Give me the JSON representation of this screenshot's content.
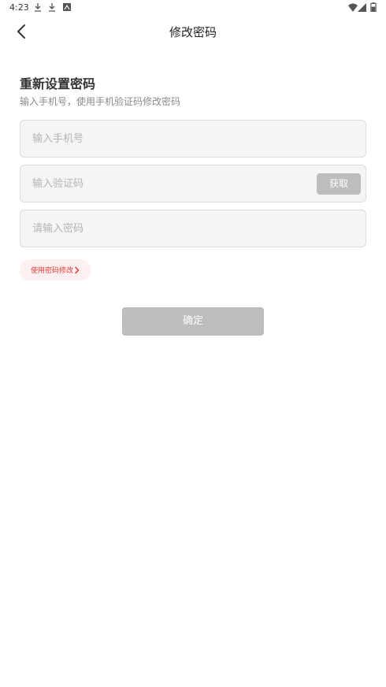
{
  "status_bar": {
    "time": "4:23",
    "icons": [
      "download-icon",
      "download-icon",
      "photo-icon",
      "wifi-icon",
      "signal-icon",
      "battery-icon"
    ]
  },
  "header": {
    "title": "修改密码",
    "back_icon": "chevron-left-icon"
  },
  "form": {
    "title": "重新设置密码",
    "subtitle": "输入手机号，使用手机验证码修改密码",
    "phone_placeholder": "输入手机号",
    "code_placeholder": "输入验证码",
    "get_code_label": "获取",
    "password_placeholder": "请输入密码",
    "switch_label": "使用密码修改",
    "switch_icon": "chevron-right-icon",
    "confirm_label": "确定"
  },
  "colors": {
    "accent_red": "#e23a3a",
    "disabled_button": "#bdbdbd",
    "field_background": "#f5f5f5"
  }
}
